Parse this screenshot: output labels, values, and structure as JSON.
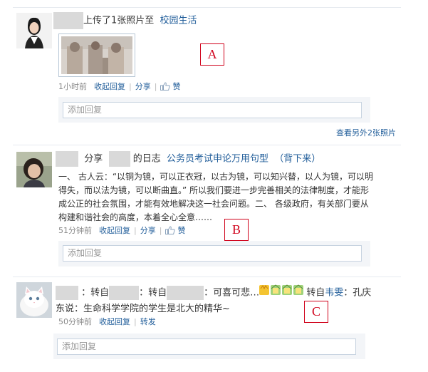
{
  "post1": {
    "action_text": "上传了1张照片至",
    "album_link": "校园生活",
    "time": "1小时前",
    "collapse_reply": "收起回复",
    "share": "分享",
    "like": "赞",
    "reply_placeholder": "添加回复",
    "more_photos": "查看另外2张照片",
    "annotation": "A"
  },
  "post2": {
    "share_word": "分享",
    "diary_word": "的日志",
    "diary_title": "公务员考试申论万用句型",
    "diary_suffix": "（背下来）",
    "body": "一、 古人云：“以铜为镜，可以正衣冠，以古为镜，可以知兴替，以人为镜，可以明得失，而以法为镜，可以断曲直。” 所以我们要进一步完善相关的法律制度，才能形成公正的社会氛围，才能有效地解决这一社会问题。二、 各级政府，有关部门要从构建和谐社会的高度，本着全心全意……",
    "time": "51分钟前",
    "collapse_reply": "收起回复",
    "share": "分享",
    "like": "赞",
    "reply_placeholder": "添加回复",
    "annotation": "B"
  },
  "post3": {
    "seg1": "：转自",
    "seg2": "：转自",
    "seg3": "：可喜可悲…",
    "seg4": "转自",
    "author_link": "韦雯",
    "seg5": "：孔庆东说：生命科学学院的学生是北大的精华~",
    "time": "50分钟前",
    "collapse_reply": "收起回复",
    "forward": "转发",
    "reply_placeholder": "添加回复",
    "annotation": "C"
  },
  "colors": {
    "link": "#1f5c99",
    "annotation": "#d0021b",
    "masked": "#d9d9d9"
  }
}
